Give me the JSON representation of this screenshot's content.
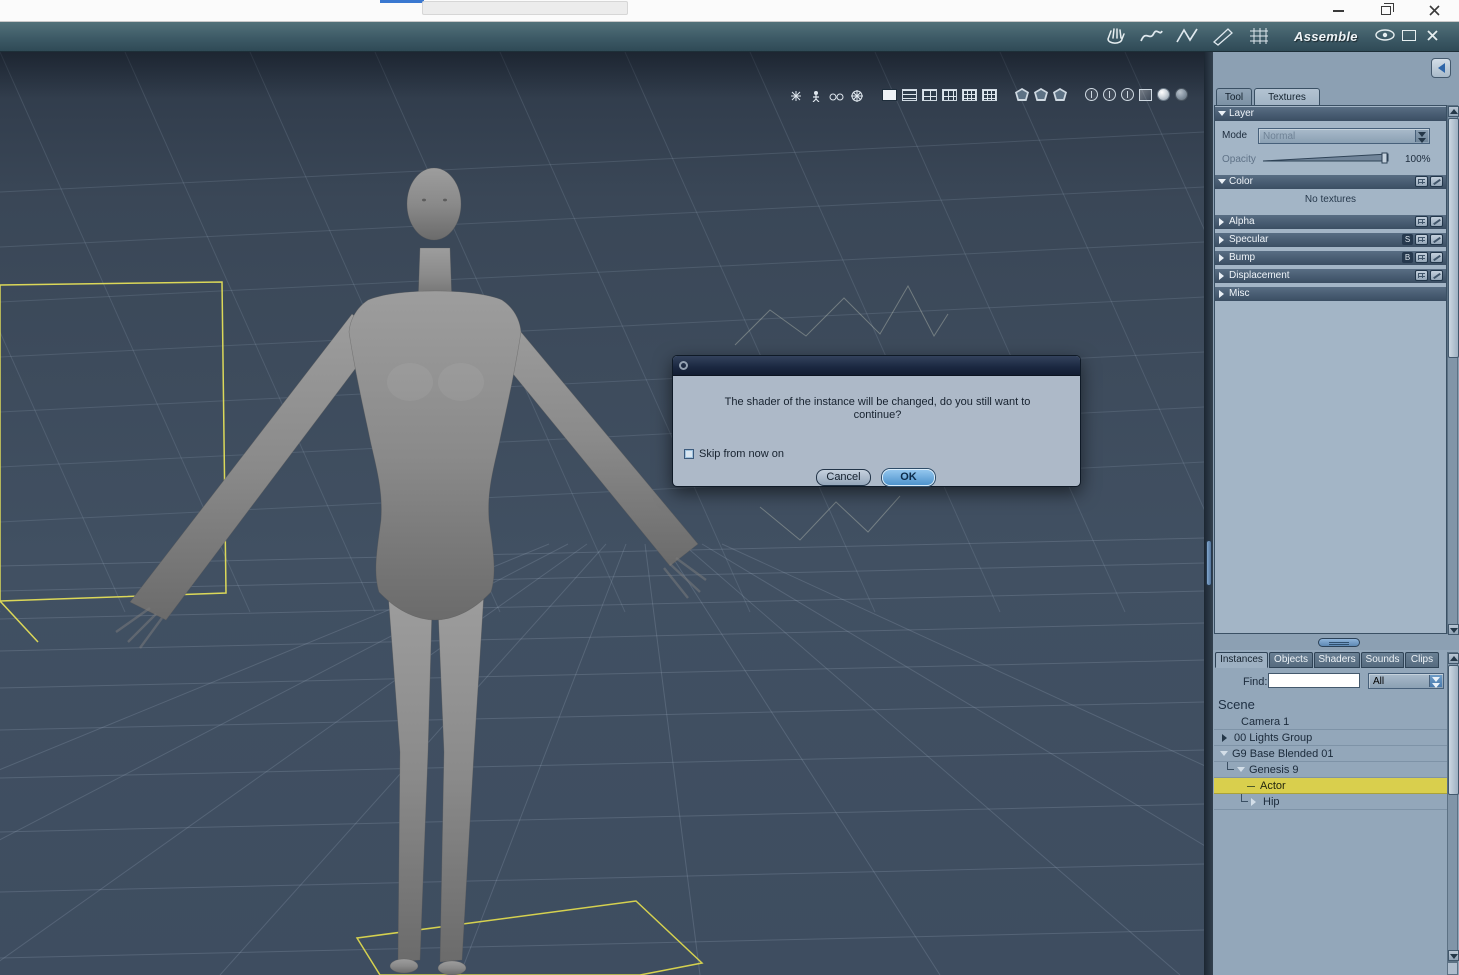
{
  "toolbar": {
    "room_label": "Assemble",
    "icons": [
      "hand-tool",
      "morph-tool",
      "spline-tool",
      "pen-tool",
      "mesh-tool",
      "visibility-eye",
      "float-window",
      "close-room"
    ]
  },
  "viewport_toolbar": {
    "icons": [
      "sparkle",
      "figure",
      "binoculars",
      "snowflake-gizmo",
      "layout-single",
      "layout-rows",
      "layout-grid-2x2",
      "layout-grid-3x2",
      "layout-grid-3x3",
      "layout-grid-dense",
      "shield-grid",
      "shield-cross",
      "shield-dot",
      "circle-compass",
      "circle-wire",
      "circle-cube",
      "cube-view",
      "sphere-smooth",
      "sphere-flat"
    ]
  },
  "dialog": {
    "message_line1": "The shader of the instance will be changed, do you still want to",
    "message_line2": "continue?",
    "checkbox_label": "Skip from now on",
    "cancel_label": "Cancel",
    "ok_label": "OK"
  },
  "texture_panel": {
    "tab_tool": "Tool",
    "tab_textures": "Textures",
    "layer_header": "Layer",
    "mode_label": "Mode",
    "mode_value": "Normal",
    "opacity_label": "Opacity",
    "opacity_value": "100%",
    "color_header": "Color",
    "color_empty_note": "No textures",
    "alpha_header": "Alpha",
    "specular_header": "Specular",
    "specular_badge": "S",
    "bump_header": "Bump",
    "bump_badge": "B",
    "displacement_header": "Displacement",
    "misc_header": "Misc"
  },
  "scene_panel": {
    "tabs": [
      "Instances",
      "Objects",
      "Shaders",
      "Sounds",
      "Clips"
    ],
    "find_label": "Find:",
    "find_value": "",
    "filter_value": "All",
    "scene_title": "Scene",
    "tree": [
      {
        "label": "Camera 1"
      },
      {
        "label": "00 Lights Group"
      },
      {
        "label": "G9 Base Blended 01"
      },
      {
        "label": "Genesis 9"
      },
      {
        "label": "Actor",
        "selected": true
      },
      {
        "label": "Hip"
      }
    ]
  },
  "colors": {
    "accent_yellow": "#e2dd55",
    "selection_yellow": "#d9cf4d",
    "ok_blue": "#5fa0d8",
    "panel_blue_gray": "#9db0c2"
  }
}
